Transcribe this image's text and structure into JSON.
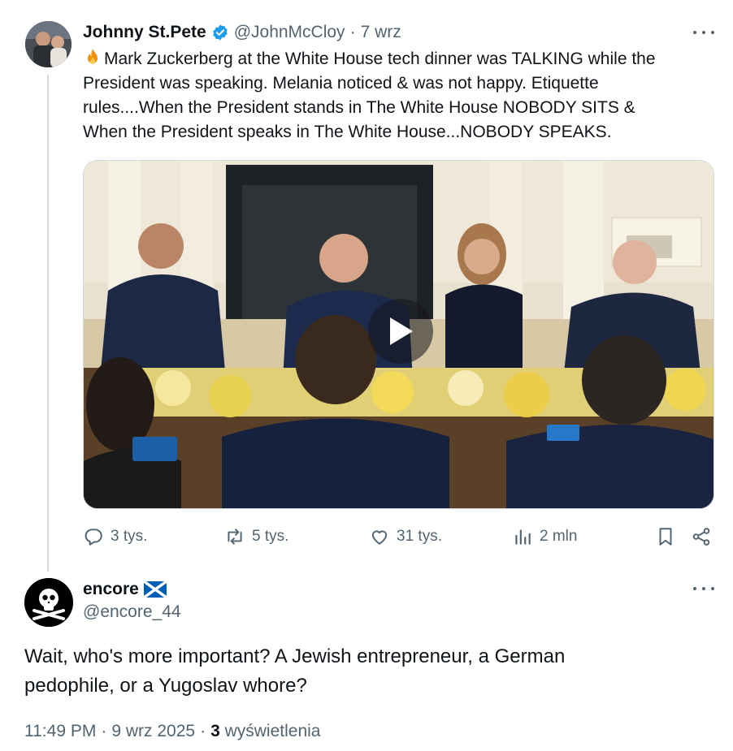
{
  "tweet": {
    "author_name": "Johnny St.Pete",
    "handle": "@JohnMcCloy",
    "separator": "·",
    "date": "7 wrz",
    "text_lines": [
      "Mark Zuckerberg at the White House tech dinner was TALKING while the",
      "President was speaking. Melania noticed & was not happy. Etiquette",
      "rules....When the President stands in The White House NOBODY SITS &",
      "When the President speaks in The White House...NOBODY SPEAKS."
    ],
    "emoji": "fire-emoji",
    "media": {
      "type": "video",
      "icon": "play-icon"
    },
    "actions": {
      "replies": "3 tys.",
      "reposts": "5 tys.",
      "likes": "31 tys.",
      "views": "2 mln"
    }
  },
  "reply": {
    "author_name": "encore",
    "flag": "scotland-flag",
    "handle": "@encore_44",
    "text_lines": [
      "Wait, who's more important? A Jewish entrepreneur, a German",
      "pedophile, or a Yugoslav whore?"
    ],
    "time": "11:49 PM",
    "sep1": "·",
    "date": "9 wrz 2025",
    "sep2": "·",
    "views_count": "3",
    "views_label": "wyświetlenia"
  },
  "colors": {
    "text": "#0f1419",
    "muted": "#536471",
    "verified": "#1d9bf0",
    "thread_line": "#cfd9de"
  }
}
